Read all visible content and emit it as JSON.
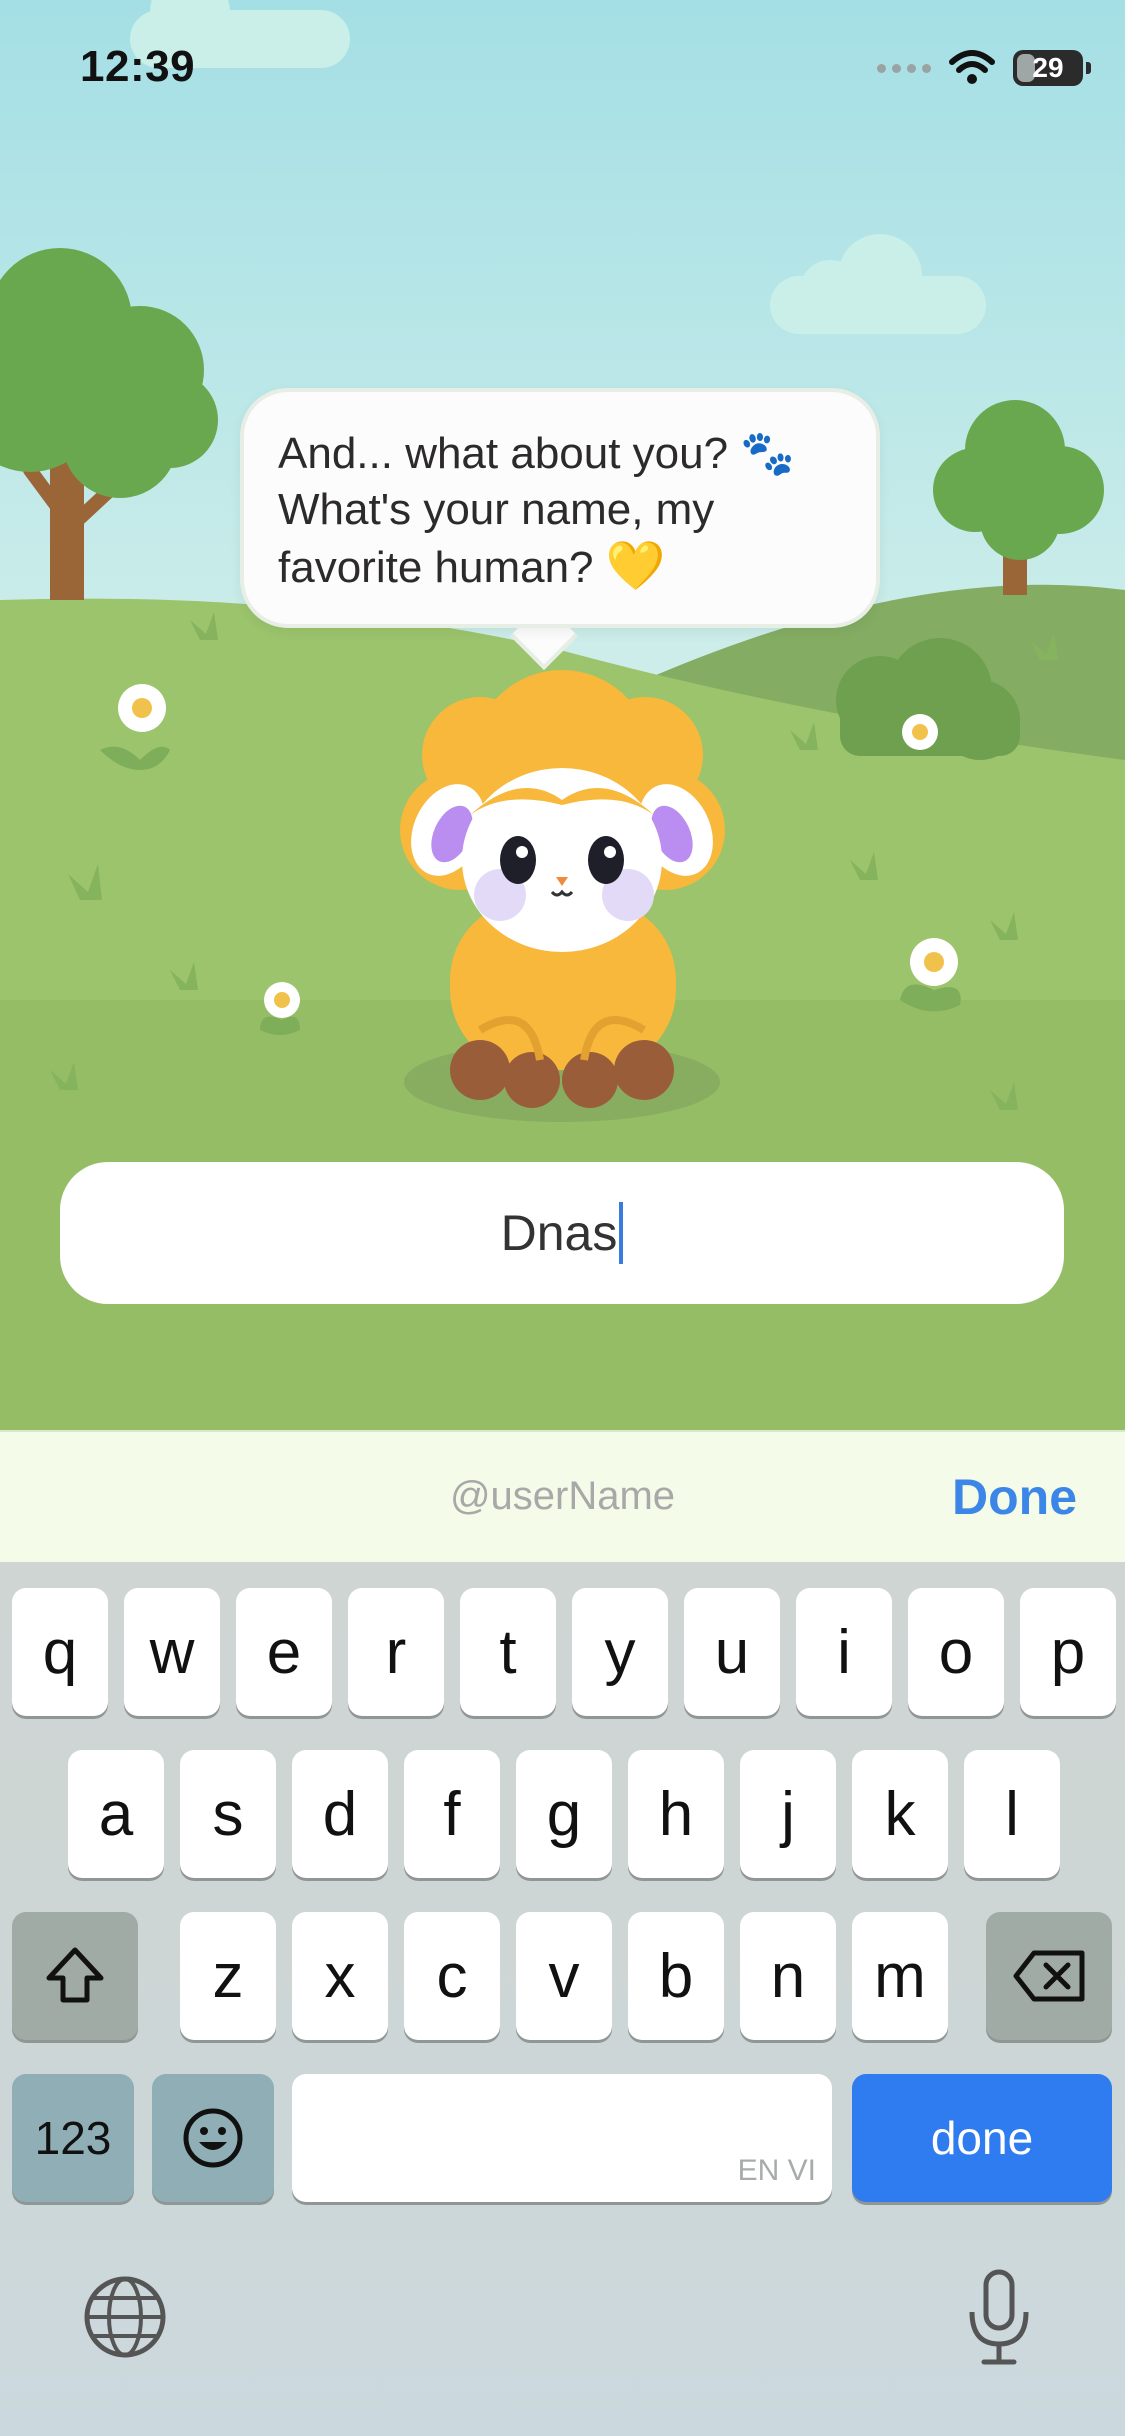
{
  "status_bar": {
    "time": "12:39",
    "battery": "29",
    "battery_fraction": 0.29
  },
  "speech": {
    "line1": "And... what about you?",
    "line1_emoji": "🐾",
    "line2": "What's your name, my",
    "line3": "favorite human?",
    "line3_emoji": "💛"
  },
  "name_field": {
    "value": "Dnas"
  },
  "accessory": {
    "handle": "@userName",
    "done_label": "Done"
  },
  "keyboard": {
    "row1": [
      "q",
      "w",
      "e",
      "r",
      "t",
      "y",
      "u",
      "i",
      "o",
      "p"
    ],
    "row2": [
      "a",
      "s",
      "d",
      "f",
      "g",
      "h",
      "j",
      "k",
      "l"
    ],
    "row3": [
      "z",
      "x",
      "c",
      "v",
      "b",
      "n",
      "m"
    ],
    "numbers_label": "123",
    "space_label": "EN VI",
    "return_label": "done"
  },
  "icons": {
    "shift": "shift-arrow-icon",
    "backspace": "backspace-icon",
    "emoji": "emoji-face-icon",
    "globe": "globe-icon",
    "mic": "microphone-icon"
  },
  "colors": {
    "accent_blue": "#3b86e6",
    "key_blue": "#2f7bf0",
    "sheep_wool": "#f7b83c"
  }
}
